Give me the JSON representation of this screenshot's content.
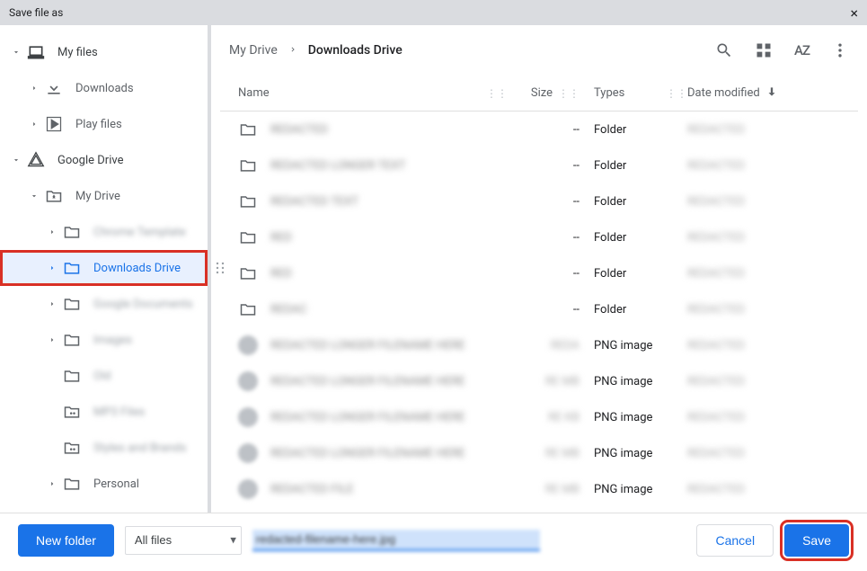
{
  "title": "Save file as",
  "sidebar": {
    "items": [
      {
        "label": "My files",
        "level": 0,
        "icon": "laptop",
        "expanded": true
      },
      {
        "label": "Downloads",
        "level": 1,
        "icon": "download",
        "expandable": true
      },
      {
        "label": "Play files",
        "level": 1,
        "icon": "play",
        "expandable": true
      },
      {
        "label": "Google Drive",
        "level": 0,
        "icon": "drive",
        "expanded": true
      },
      {
        "label": "My Drive",
        "level": 1,
        "icon": "mydrive",
        "expanded": true
      },
      {
        "label": "Chrome Template",
        "level": 2,
        "icon": "folder",
        "blurred": true,
        "expandable": true
      },
      {
        "label": "Downloads Drive",
        "level": 2,
        "icon": "folder",
        "selected": true,
        "highlighted": true,
        "expandable": true
      },
      {
        "label": "Google Documents",
        "level": 2,
        "icon": "folder",
        "blurred": true,
        "expandable": true
      },
      {
        "label": "Images",
        "level": 2,
        "icon": "folder",
        "blurred": true,
        "expandable": true
      },
      {
        "label": "Old",
        "level": 2,
        "icon": "folder",
        "blurred": true
      },
      {
        "label": "MP3 Files",
        "level": 2,
        "icon": "shared-folder",
        "blurred": true
      },
      {
        "label": "Styles and Brands",
        "level": 2,
        "icon": "shared-folder",
        "blurred": true
      },
      {
        "label": "Personal",
        "level": 2,
        "icon": "folder",
        "expandable": true
      }
    ]
  },
  "breadcrumb": {
    "parent": "My Drive",
    "current": "Downloads Drive"
  },
  "columns": {
    "name": "Name",
    "size": "Size",
    "types": "Types",
    "date": "Date modified"
  },
  "files": [
    {
      "name": "REDACTED",
      "size": "--",
      "type": "Folder",
      "date": "REDACTED",
      "kind": "folder",
      "blurred": true
    },
    {
      "name": "REDACTED LONGER TEXT",
      "size": "--",
      "type": "Folder",
      "date": "REDACTED",
      "kind": "folder",
      "blurred": true
    },
    {
      "name": "REDACTED TEXT",
      "size": "--",
      "type": "Folder",
      "date": "REDACTED",
      "kind": "folder",
      "blurred": true
    },
    {
      "name": "RED",
      "size": "--",
      "type": "Folder",
      "date": "REDACTED",
      "kind": "folder",
      "blurred": true
    },
    {
      "name": "RED",
      "size": "--",
      "type": "Folder",
      "date": "REDACTED",
      "kind": "folder",
      "blurred": true
    },
    {
      "name": "REDAC",
      "size": "--",
      "type": "Folder",
      "date": "REDACTED",
      "kind": "folder",
      "blurred": true
    },
    {
      "name": "REDACTED LONGER FILENAME HERE",
      "size": "REDA",
      "type": "PNG image",
      "date": "REDACTED",
      "kind": "image",
      "blurred": true
    },
    {
      "name": "REDACTED LONGER FILENAME HERE",
      "size": "RE MB",
      "type": "PNG image",
      "date": "REDACTED",
      "kind": "image",
      "blurred": true
    },
    {
      "name": "REDACTED LONGER FILENAME HERE",
      "size": "RE KB",
      "type": "PNG image",
      "date": "REDACTED",
      "kind": "image",
      "blurred": true
    },
    {
      "name": "REDACTED LONGER FILENAME HERE",
      "size": "RE MB",
      "type": "PNG image",
      "date": "REDACTED",
      "kind": "image",
      "blurred": true
    },
    {
      "name": "REDACTED FILE",
      "size": "RE MB",
      "type": "PNG image",
      "date": "REDACTED",
      "kind": "image",
      "blurred": true
    }
  ],
  "footer": {
    "new_folder": "New folder",
    "filter": "All files",
    "filename": "redacted-filename-here.jpg",
    "cancel": "Cancel",
    "save": "Save"
  }
}
